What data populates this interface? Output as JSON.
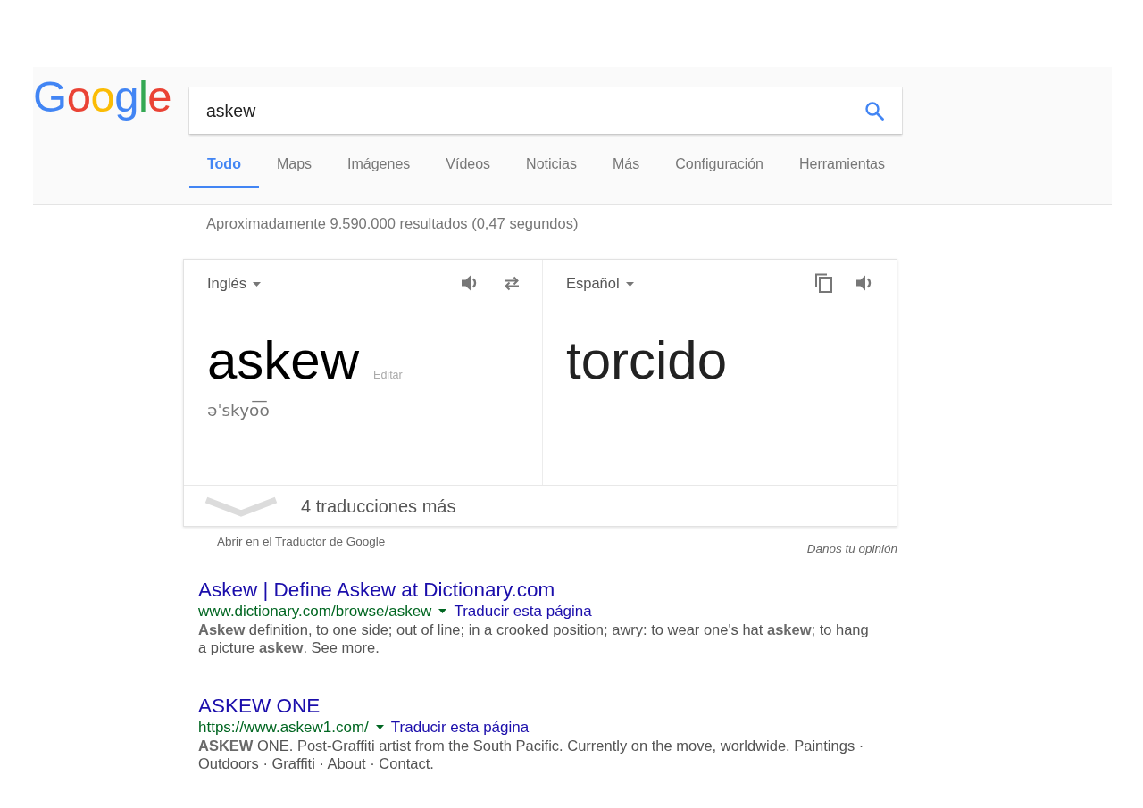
{
  "logo": {
    "text": "Google"
  },
  "search": {
    "value": "askew"
  },
  "tabs": [
    {
      "label": "Todo",
      "selected": true
    },
    {
      "label": "Maps",
      "selected": false
    },
    {
      "label": "Imágenes",
      "selected": false
    },
    {
      "label": "Vídeos",
      "selected": false
    },
    {
      "label": "Noticias",
      "selected": false
    },
    {
      "label": "Más",
      "selected": false
    }
  ],
  "menus": [
    "Configuración",
    "Herramientas"
  ],
  "result_stats": "Aproximadamente 9.590.000 resultados (0,47 segundos)",
  "translation": {
    "source": {
      "language": "Inglés",
      "text": "askew",
      "edit_label": "Editar",
      "pronunciation": "əˈskyo͞o"
    },
    "target": {
      "language": "Español",
      "text": "torcido"
    },
    "more": "4 traducciones más",
    "open_link": "Abrir en el Traductor de Google",
    "feedback": "Danos tu opinión"
  },
  "results": [
    {
      "title": "Askew | Define Askew at Dictionary.com",
      "url": "www.dictionary.com/browse/askew",
      "translate_link": "Traducir esta página",
      "snippet": "**Askew** definition, to one side; out of line; in a crooked position; awry: to wear one's hat **askew**; to hang a picture **askew**. See more."
    },
    {
      "title": "ASKEW ONE",
      "url": "https://www.askew1.com/",
      "translate_link": "Traducir esta página",
      "snippet": "**ASKEW** ONE. Post-Graffiti artist from the South Pacific. Currently on the move, worldwide. Paintings · Outdoors · Graffiti · About · Contact."
    }
  ]
}
